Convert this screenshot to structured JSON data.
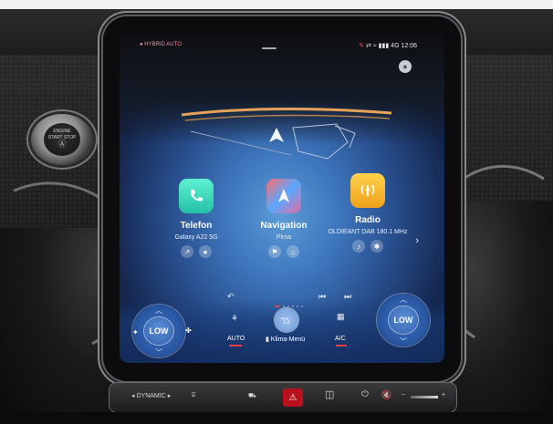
{
  "status_bar": {
    "left_badge": "HYBRID AUTO",
    "signal": "4G",
    "time": "12:06"
  },
  "apps": [
    {
      "title": "Telefon",
      "subtitle": "Galaxy A22 5G",
      "icon": "phone-icon",
      "color": "#25c1a6"
    },
    {
      "title": "Navigation",
      "subtitle": "Pirna",
      "icon": "navigation-arrow-icon",
      "color": "#e46ba2"
    },
    {
      "title": "Radio",
      "subtitle": "OLDIEANT DAB 180.1 MHz",
      "icon": "radio-icon",
      "color": "#f0a21c"
    }
  ],
  "climate": {
    "left_fan": "LOW",
    "right_fan": "LOW",
    "auto_label": "AUTO",
    "menu_label": "Klima-Menü",
    "ac_label": "A/C"
  },
  "button_strip": {
    "dynamic_label": "DYNAMIC"
  },
  "engine_button": {
    "line1": "ENGINE",
    "line2": "START STOP"
  },
  "colors": {
    "accent_red": "#ff3b48",
    "screen_blue": "#3e76bd",
    "hazard_red": "#b8111d"
  }
}
